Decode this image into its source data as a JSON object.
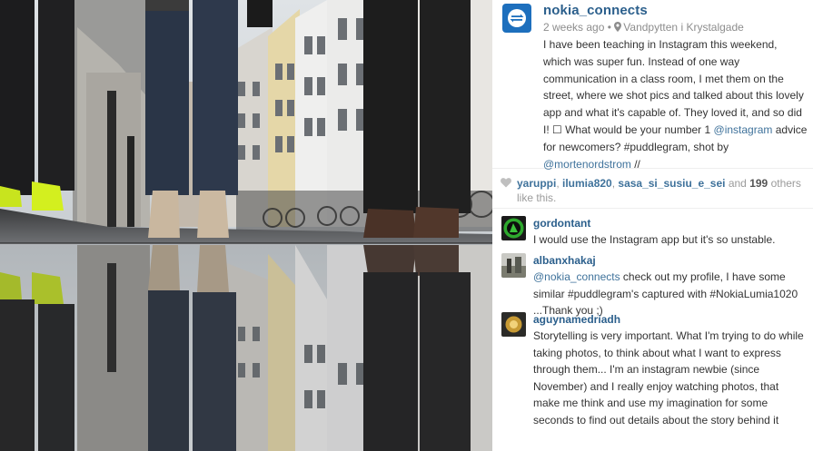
{
  "photo": {
    "description_icon": "photo-street-puddle-reflection"
  },
  "post": {
    "username": "nokia_connects",
    "time_ago": "2 weeks ago",
    "separator": "•",
    "location": "Vandpytten i Krystalgade",
    "caption_text": "I have been teaching in Instagram this weekend, which was super fun. Instead of one way communication in a class room, I met them on the street, where we shot pics and talked about this lovely app and what it's capable of. They loved it, and so did I! ☐ What would be your number 1 ",
    "caption_mention": "@instagram",
    "caption_text2": " advice for newcomers? #puddlegram, shot by ",
    "caption_mention2": "@mortenordstrom",
    "caption_end": " //"
  },
  "likes": {
    "liker1": "yaruppi",
    "sep1": ", ",
    "liker2": "ilumia820",
    "sep2": ", ",
    "liker3": "sasa_si_susiu_e_sei",
    "and": " and ",
    "count": "199",
    "suffix": " others like this."
  },
  "comments": [
    {
      "username": "gordontant",
      "text": "I would use the Instagram app but it's so unstable."
    },
    {
      "username": "albanxhakaj",
      "mention": "@nokia_connects",
      "text": " check out my profile, I have some similar #puddlegram's captured with #NokiaLumia1020 ...Thank you ;)"
    },
    {
      "username": "aguynamedriadh",
      "text": "Storytelling is very important. What I'm trying to do while taking photos, to think about what I want to express through them... I'm an instagram newbie (since November) and I really enjoy watching photos, that make me think and use my imagination for some seconds to find out details about the story behind it"
    }
  ],
  "colors": {
    "username": "#2b5f8c",
    "link": "#3f729b",
    "meta": "#8d8d8d",
    "nokia_blue": "#1d6fbd"
  }
}
